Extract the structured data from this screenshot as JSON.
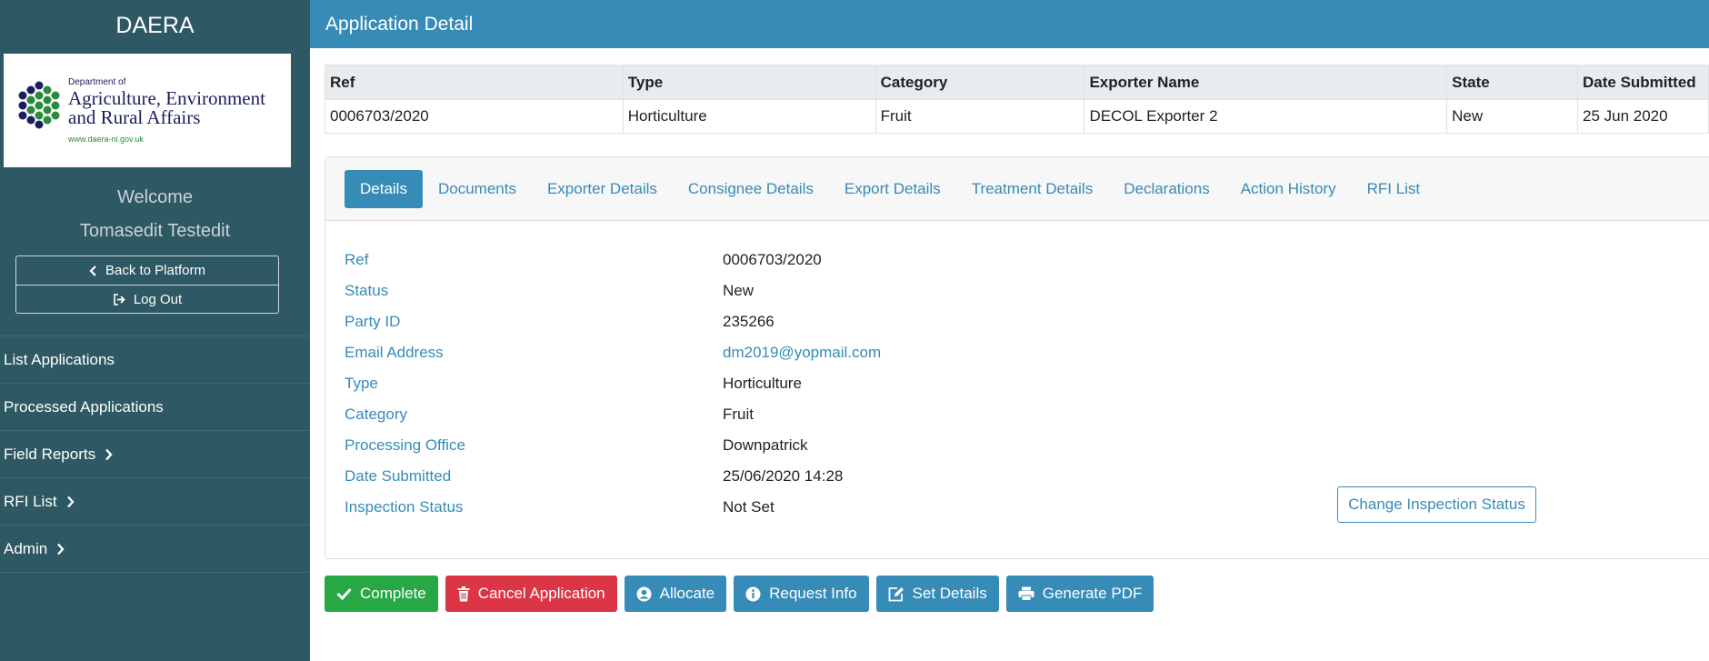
{
  "sidebar": {
    "title": "DAERA",
    "logo": {
      "line_small": "Department of",
      "line1": "Agriculture, Environment",
      "line2": "and Rural Affairs",
      "url": "www.daera-ni.gov.uk"
    },
    "welcome": "Welcome",
    "username": "Tomasedit Testedit",
    "back_label": "Back to Platform",
    "logout_label": "Log Out",
    "nav": [
      {
        "label": "List Applications"
      },
      {
        "label": "Processed Applications"
      },
      {
        "label": "Field Reports"
      },
      {
        "label": "RFI List"
      },
      {
        "label": "Admin"
      }
    ]
  },
  "header": {
    "title": "Application Detail"
  },
  "summary": {
    "columns": [
      "Ref",
      "Type",
      "Category",
      "Exporter Name",
      "State",
      "Date Submitted"
    ],
    "row": [
      "0006703/2020",
      "Horticulture",
      "Fruit",
      "DECOL Exporter 2",
      "New",
      "25 Jun 2020"
    ]
  },
  "tabs": [
    "Details",
    "Documents",
    "Exporter Details",
    "Consignee Details",
    "Export Details",
    "Treatment Details",
    "Declarations",
    "Action History",
    "RFI List"
  ],
  "details": [
    {
      "label": "Ref",
      "value": "0006703/2020"
    },
    {
      "label": "Status",
      "value": "New"
    },
    {
      "label": "Party ID",
      "value": "235266"
    },
    {
      "label": "Email Address",
      "value": "dm2019@yopmail.com"
    },
    {
      "label": "Type",
      "value": "Horticulture"
    },
    {
      "label": "Category",
      "value": "Fruit"
    },
    {
      "label": "Processing Office",
      "value": "Downpatrick"
    },
    {
      "label": "Date Submitted",
      "value": "25/06/2020 14:28"
    },
    {
      "label": "Inspection Status",
      "value": "Not Set"
    }
  ],
  "change_inspection_label": "Change Inspection Status",
  "actions": {
    "complete": "Complete",
    "cancel": "Cancel Application",
    "allocate": "Allocate",
    "request_info": "Request Info",
    "set_details": "Set Details",
    "generate_pdf": "Generate PDF"
  },
  "colors": {
    "primary": "#368bb7",
    "sidebar": "#2e5863",
    "success": "#28a745",
    "danger": "#dc3545"
  }
}
